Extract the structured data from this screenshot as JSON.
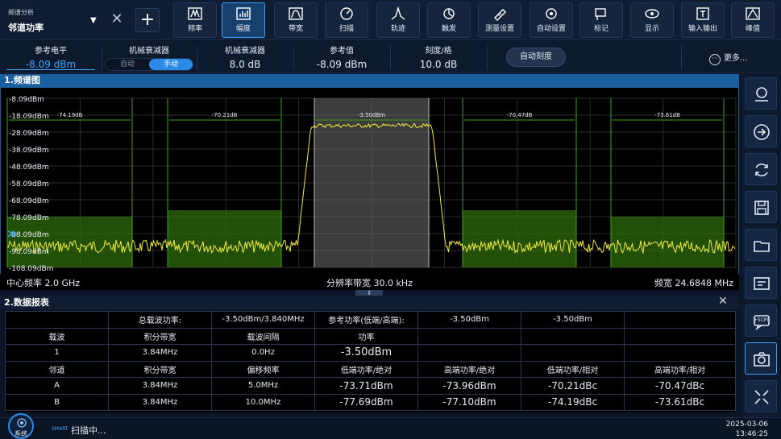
{
  "mode": {
    "category": "频谱分析",
    "name": "邻道功率"
  },
  "toolbar": [
    {
      "id": "freq",
      "label": "频率",
      "icon": "freq-icon"
    },
    {
      "id": "amp",
      "label": "幅度",
      "icon": "amplitude-icon",
      "active": true
    },
    {
      "id": "bw",
      "label": "带宽",
      "icon": "bandwidth-icon"
    },
    {
      "id": "sweep",
      "label": "扫描",
      "icon": "sweep-icon"
    },
    {
      "id": "trace",
      "label": "轨迹",
      "icon": "trace-icon"
    },
    {
      "id": "trig",
      "label": "触发",
      "icon": "trigger-icon"
    },
    {
      "id": "meas",
      "label": "测量设置",
      "icon": "measure-setup-icon"
    },
    {
      "id": "auto",
      "label": "自动设置",
      "icon": "auto-setup-icon"
    },
    {
      "id": "marker",
      "label": "标记",
      "icon": "marker-icon"
    },
    {
      "id": "display",
      "label": "显示",
      "icon": "display-icon"
    },
    {
      "id": "io",
      "label": "输入输出",
      "icon": "io-icon"
    },
    {
      "id": "peak",
      "label": "峰值",
      "icon": "peak-icon"
    }
  ],
  "params": {
    "ref_level_label": "参考电平",
    "ref_level_value": "-8.09 dBm",
    "attenuator_label": "机械衰减器",
    "att_auto": "自动",
    "att_manual": "手动",
    "att_value_label": "机械衰减器",
    "att_value": "8.0 dB",
    "ref_value_label": "参考值",
    "ref_value": "-8.09 dBm",
    "scale_label": "刻度/格",
    "scale_value": "10.0 dB",
    "auto_scale": "自动刻度",
    "more": "更多..."
  },
  "spectrum": {
    "title": "1.频谱图",
    "y_labels": [
      "-8.09dBm",
      "-18.09dBm",
      "-28.09dBm",
      "-38.09dBm",
      "-48.09dBm",
      "-58.09dBm",
      "-68.09dBm",
      "-78.09dBm",
      "-88.09dBm",
      "-98.09dBm",
      "-108.09dBm"
    ],
    "center_freq": "中心频率 2.0 GHz",
    "rbw": "分辨率带宽 30.0 kHz",
    "span": "频宽 24.6848 MHz",
    "channel_labels": [
      "-74.19dB",
      "-70.21dB",
      "-3.50dBm",
      "-70.47dB",
      "-73.61dB"
    ]
  },
  "report": {
    "title": "2.数据报表",
    "rows": [
      [
        "",
        "总载波功率:",
        "-3.50dBm/3.840MHz",
        "参考功率(低端/高端):",
        "-3.50dBm",
        "-3.50dBm",
        ""
      ],
      [
        "载波",
        "积分带宽",
        "载波间隔",
        "功率",
        "",
        "",
        ""
      ],
      [
        "1",
        "3.84MHz",
        "0.0Hz",
        "-3.50dBm",
        "",
        "",
        ""
      ],
      [
        "邻道",
        "积分带宽",
        "偏移频率",
        "低端功率/绝对",
        "高端功率/绝对",
        "低端功率/相对",
        "高端功率/相对"
      ],
      [
        "A",
        "3.84MHz",
        "5.0MHz",
        "-73.71dBm",
        "-73.96dBm",
        "-70.21dBc",
        "-70.47dBc"
      ],
      [
        "B",
        "3.84MHz",
        "10.0MHz",
        "-77.69dBm",
        "-77.10dBm",
        "-74.19dBc",
        "-73.61dBc"
      ]
    ]
  },
  "side_buttons": [
    "measure-icon",
    "arrow-right-icon",
    "refresh-icon",
    "save-icon",
    "folder-icon",
    "screen-capture-icon",
    "scpi-icon",
    "camera-icon",
    "expand-icon"
  ],
  "side_scpi_label": "+SCPI",
  "status": {
    "system": "系统",
    "brand": "SMART",
    "scanning": "扫描中...",
    "date": "2025-03-06",
    "time": "13:46:25"
  }
}
